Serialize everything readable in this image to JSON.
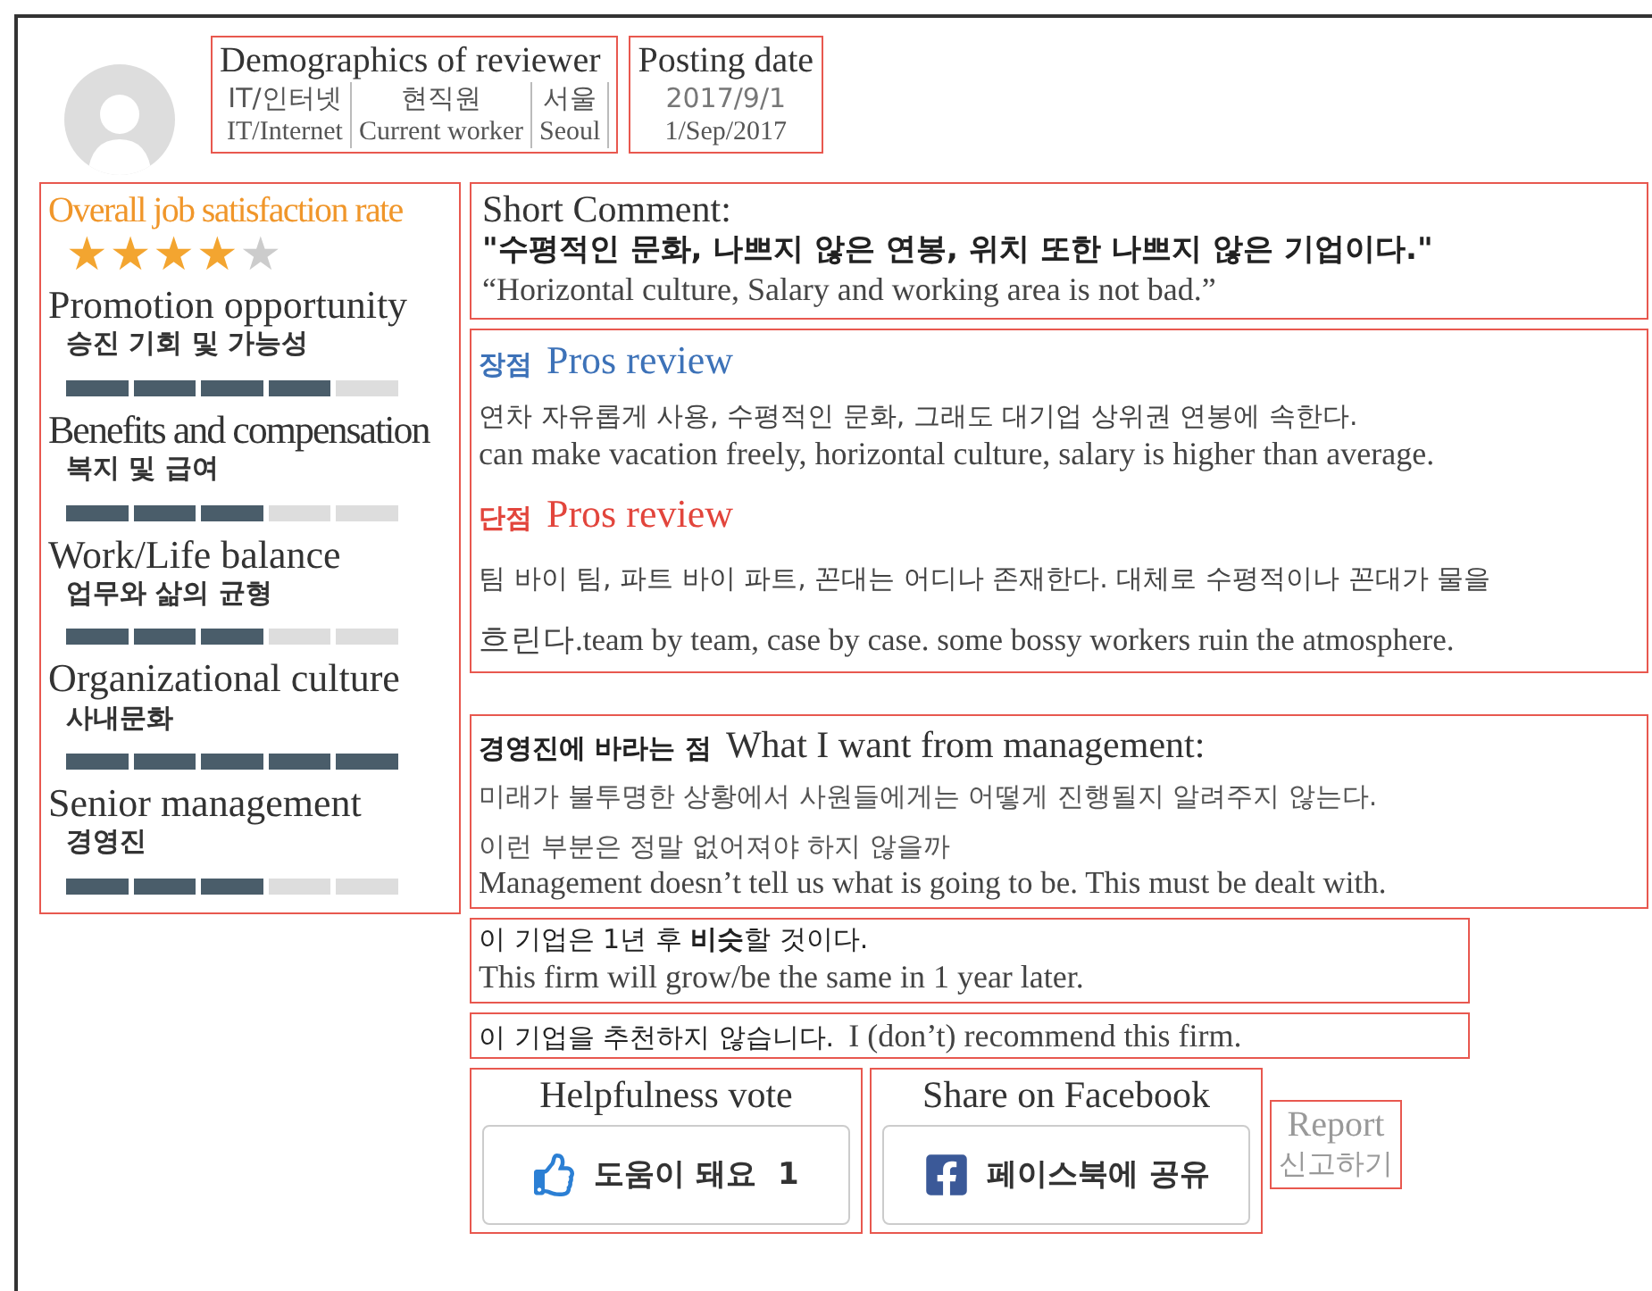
{
  "demographics": {
    "title": "Demographics of reviewer",
    "fields": [
      {
        "ko": "IT/인터넷",
        "en": "IT/Internet"
      },
      {
        "ko": "현직원",
        "en": "Current worker"
      },
      {
        "ko": "서울",
        "en": "Seoul"
      }
    ]
  },
  "posting_date": {
    "title": "Posting date",
    "ko": "2017/9/1",
    "en": "1/Sep/2017"
  },
  "overall": {
    "title": "Overall job satisfaction rate",
    "stars": 4
  },
  "ratings": [
    {
      "en": "Promotion opportunity",
      "ko": "승진 기회 및 가능성",
      "level": 0.8
    },
    {
      "en": "Benefits and compensation",
      "ko": "복지 및 급여",
      "level": 0.6
    },
    {
      "en": "Work/Life balance",
      "ko": "업무와 삶의 균형",
      "level": 0.6
    },
    {
      "en": "Organizational culture",
      "ko": "사내문화",
      "level": 1
    },
    {
      "en": "Senior management",
      "ko": "경영진",
      "level": 0.6
    }
  ],
  "short_comment": {
    "title": "Short Comment:",
    "ko": "\"수평적인 문화, 나쁘지 않은 연봉, 위치 또한 나쁘지 않은 기업이다.\"",
    "en": "“Horizontal culture, Salary and working area is not bad.”"
  },
  "reviews": [
    {
      "kind": "pro",
      "ko_label": "장점",
      "en_label": "Pros review",
      "lines": [
        "연차 자유롭게 사용, 수평적인 문화, 그래도 대기업 상위권 연봉에 속한다.",
        "can make vacation freely, horizontal culture, salary is higher than average."
      ]
    },
    {
      "kind": "con",
      "ko_label": "단점",
      "en_label": "Pros review",
      "lines": [
        "팀 바이 팀, 파트 바이 파트, 꼰대는 어디나 존재한다. 대체로 수평적이나 꼰대가 물을",
        "흐린다.team by team, case by case. some bossy workers ruin the atmosphere."
      ]
    }
  ],
  "management": {
    "ko_label": "경영진에 바라는 점",
    "title": "What I want from management:",
    "lines": [
      "미래가 불투명한 상황에서 사원들에게는 어떻게 진행될지 알려주지 않는다.",
      "이런 부분은 정말 없어져야 하지 않을까"
    ],
    "en": "Management doesn’t tell us what is going to be. This must be dealt with."
  },
  "outlook": {
    "ko": "이 기업은 1년 후 **비슷**할 것이다.",
    "en": "This firm will grow/be the same in 1 year later."
  },
  "recommendation": {
    "ko": "이 기업을 추천하지 않습니다.",
    "en": "I (don’t) recommend this firm."
  },
  "helpfulness": {
    "title": "Helpfulness vote",
    "label": "도움이 돼요",
    "count": "1"
  },
  "share": {
    "title": "Share on Facebook",
    "label": "페이스북에 공유"
  },
  "report": {
    "en": "Report",
    "ko": "신고하기"
  }
}
